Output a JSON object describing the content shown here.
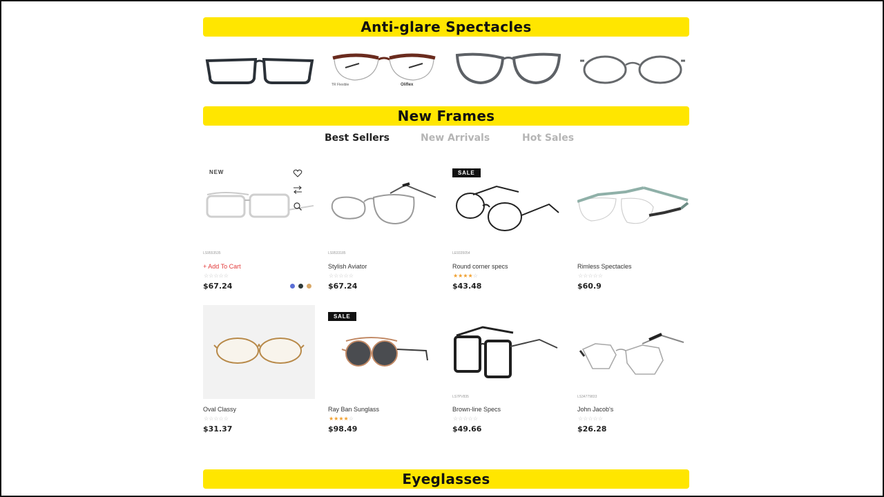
{
  "sections": {
    "anti_glare_title": "Anti-glare Spectacles",
    "new_frames_title": "New Frames",
    "eyeglasses_title": "Eyeglasses"
  },
  "anti_glare_items": [
    {
      "icon": "rectangle-black-frame"
    },
    {
      "icon": "browline-brown-frame"
    },
    {
      "icon": "round-grey-frame"
    },
    {
      "icon": "round-thin-grey-frame"
    }
  ],
  "ag_item2_caption_left": "TR Flexible",
  "ag_item2_caption_right": "Oliflex",
  "tabs": [
    {
      "label": "Best Sellers",
      "active": true
    },
    {
      "label": "New Arrivals",
      "active": false
    },
    {
      "label": "Hot Sales",
      "active": false
    }
  ],
  "products": [
    {
      "name": "",
      "sku": "LS9553535",
      "price": "$67.24",
      "rating": 0,
      "badge": "NEW",
      "add_to_cart": "+ Add To Cart",
      "swatches": [
        "#5b6fd6",
        "#2e3a3a",
        "#d9a96a"
      ]
    },
    {
      "name": "Stylish Aviator",
      "sku": "LS9533185",
      "price": "$67.24",
      "rating": 0,
      "badge": ""
    },
    {
      "name": "Round corner specs",
      "sku": "LE9335054",
      "price": "$43.48",
      "rating": 4,
      "badge": "SALE"
    },
    {
      "name": "Rimless Spectacles",
      "sku": "",
      "price": "$60.9",
      "rating": 0,
      "badge": ""
    },
    {
      "name": "Oval Classy",
      "sku": "",
      "price": "$31.37",
      "rating": 0,
      "badge": ""
    },
    {
      "name": "Ray Ban Sunglass",
      "sku": "",
      "price": "$98.49",
      "rating": 4,
      "badge": "SALE"
    },
    {
      "name": "Brown-line Specs",
      "sku": "LS7PV835",
      "price": "$49.66",
      "rating": 0,
      "badge": ""
    },
    {
      "name": "John Jacob's",
      "sku": "LS34779833",
      "price": "$26.28",
      "rating": 0,
      "badge": ""
    }
  ],
  "rating_max": 5,
  "colors": {
    "banner": "#ffe600",
    "accent_red": "#e23a3a",
    "star": "#f0a030",
    "badge_bg": "#111111"
  },
  "icons": {
    "wishlist": "heart-icon",
    "compare": "compare-arrows-icon",
    "quickview": "search-icon"
  }
}
